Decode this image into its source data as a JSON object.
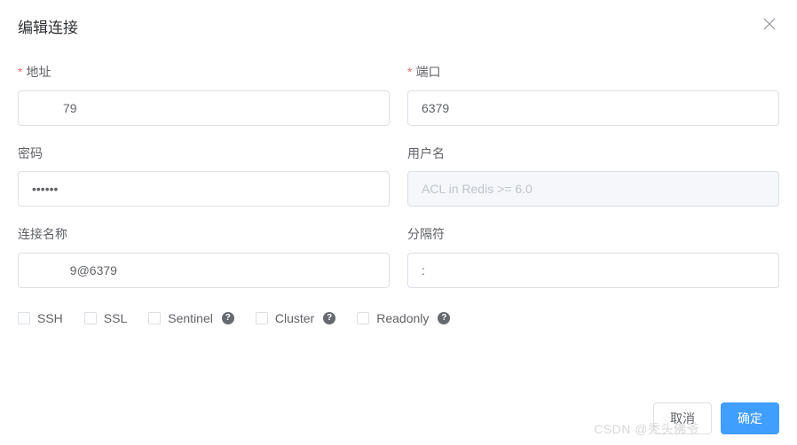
{
  "dialog": {
    "title": "编辑连接"
  },
  "fields": {
    "address": {
      "label": "地址",
      "value": "         79"
    },
    "port": {
      "label": "端口",
      "value": "6379"
    },
    "password": {
      "label": "密码",
      "value": "••••••"
    },
    "username": {
      "label": "用户名",
      "value": "",
      "placeholder": "ACL in Redis >= 6.0"
    },
    "connName": {
      "label": "连接名称",
      "value": "           9@6379"
    },
    "separator": {
      "label": "分隔符",
      "value": ":"
    }
  },
  "options": {
    "ssh": "SSH",
    "ssl": "SSL",
    "sentinel": "Sentinel",
    "cluster": "Cluster",
    "readonly": "Readonly"
  },
  "footer": {
    "cancel": "取消",
    "confirm": "确定"
  },
  "watermark": "CSDN @秃头佛爷"
}
